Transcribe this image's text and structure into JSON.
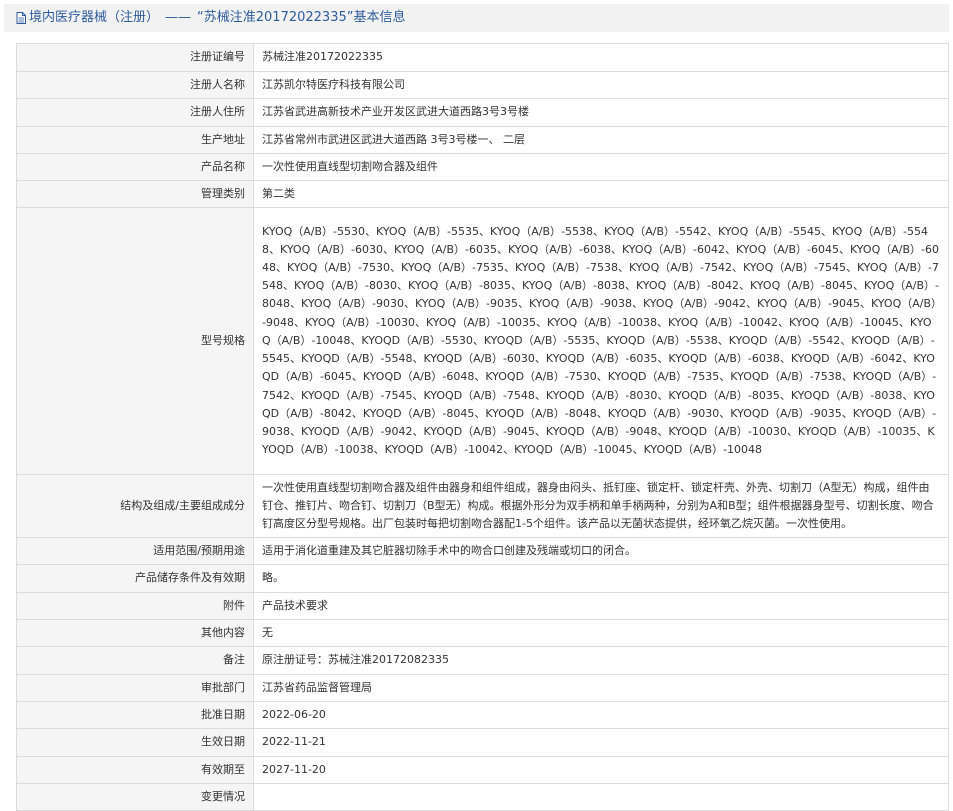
{
  "header": {
    "section": "境内医疗器械（注册）",
    "separator": "——",
    "name": "“苏械注准20172022335”基本信息"
  },
  "rows": [
    {
      "label": "注册证编号",
      "value": "苏械注准20172022335"
    },
    {
      "label": "注册人名称",
      "value": "江苏凯尔特医疗科技有限公司"
    },
    {
      "label": "注册人住所",
      "value": "江苏省武进高新技术产业开发区武进大道西路3号3号楼"
    },
    {
      "label": "生产地址",
      "value": "江苏省常州市武进区武进大道西路 3号3号楼一、 二层"
    },
    {
      "label": "产品名称",
      "value": "一次性使用直线型切割吻合器及组件"
    },
    {
      "label": "管理类别",
      "value": "第二类"
    },
    {
      "label": "型号规格",
      "value": "KYOQ（A/B）-5530、KYOQ（A/B）-5535、KYOQ（A/B）-5538、KYOQ（A/B）-5542、KYOQ（A/B）-5545、KYOQ（A/B）-5548、KYOQ（A/B）-6030、KYOQ（A/B）-6035、KYOQ（A/B）-6038、KYOQ（A/B）-6042、KYOQ（A/B）-6045、KYOQ（A/B）-6048、KYOQ（A/B）-7530、KYOQ（A/B）-7535、KYOQ（A/B）-7538、KYOQ（A/B）-7542、KYOQ（A/B）-7545、KYOQ（A/B）-7548、KYOQ（A/B）-8030、KYOQ（A/B）-8035、KYOQ（A/B）-8038、KYOQ（A/B）-8042、KYOQ（A/B）-8045、KYOQ（A/B）-8048、KYOQ（A/B）-9030、KYOQ（A/B）-9035、KYOQ（A/B）-9038、KYOQ（A/B）-9042、KYOQ（A/B）-9045、KYOQ（A/B）-9048、KYOQ（A/B）-10030、KYOQ（A/B）-10035、KYOQ（A/B）-10038、KYOQ（A/B）-10042、KYOQ（A/B）-10045、KYOQ（A/B）-10048、KYOQD（A/B）-5530、KYOQD（A/B）-5535、KYOQD（A/B）-5538、KYOQD（A/B）-5542、KYOQD（A/B）-5545、KYOQD（A/B）-5548、KYOQD（A/B）-6030、KYOQD（A/B）-6035、KYOQD（A/B）-6038、KYOQD（A/B）-6042、KYOQD（A/B）-6045、KYOQD（A/B）-6048、KYOQD（A/B）-7530、KYOQD（A/B）-7535、KYOQD（A/B）-7538、KYOQD（A/B）-7542、KYOQD（A/B）-7545、KYOQD（A/B）-7548、KYOQD（A/B）-8030、KYOQD（A/B）-8035、KYOQD（A/B）-8038、KYOQD（A/B）-8042、KYOQD（A/B）-8045、KYOQD（A/B）-8048、KYOQD（A/B）-9030、KYOQD（A/B）-9035、KYOQD（A/B）-9038、KYOQD（A/B）-9042、KYOQD（A/B）-9045、KYOQD（A/B）-9048、KYOQD（A/B）-10030、KYOQD（A/B）-10035、KYOQD（A/B）-10038、KYOQD（A/B）-10042、KYOQD（A/B）-10045、KYOQD（A/B）-10048"
    },
    {
      "label": "结构及组成/主要组成成分",
      "value": "一次性使用直线型切割吻合器及组件由器身和组件组成，器身由闷头、抵钉座、锁定杆、锁定杆壳、外壳、切割刀（A型无）构成，组件由钉仓、推钉片、吻合钉、切割刀（B型无）构成。根据外形分为双手柄和单手柄两种，分别为A和B型；组件根据器身型号、切割长度、吻合钉高度区分型号规格。出厂包装时每把切割吻合器配1-5个组件。该产品以无菌状态提供，经环氧乙烷灭菌。一次性使用。"
    },
    {
      "label": "适用范围/预期用途",
      "value": "适用于消化道重建及其它脏器切除手术中的吻合口创建及残端或切口的闭合。"
    },
    {
      "label": "产品储存条件及有效期",
      "value": "略。"
    },
    {
      "label": "附件",
      "value": "产品技术要求"
    },
    {
      "label": "其他内容",
      "value": "无"
    },
    {
      "label": "备注",
      "value": "原注册证号：苏械注准20172082335"
    },
    {
      "label": "审批部门",
      "value": "江苏省药品监督管理局"
    },
    {
      "label": "批准日期",
      "value": "2022-06-20"
    },
    {
      "label": "生效日期",
      "value": "2022-11-21"
    },
    {
      "label": "有效期至",
      "value": "2027-11-20"
    },
    {
      "label": "变更情况",
      "value": ""
    }
  ]
}
